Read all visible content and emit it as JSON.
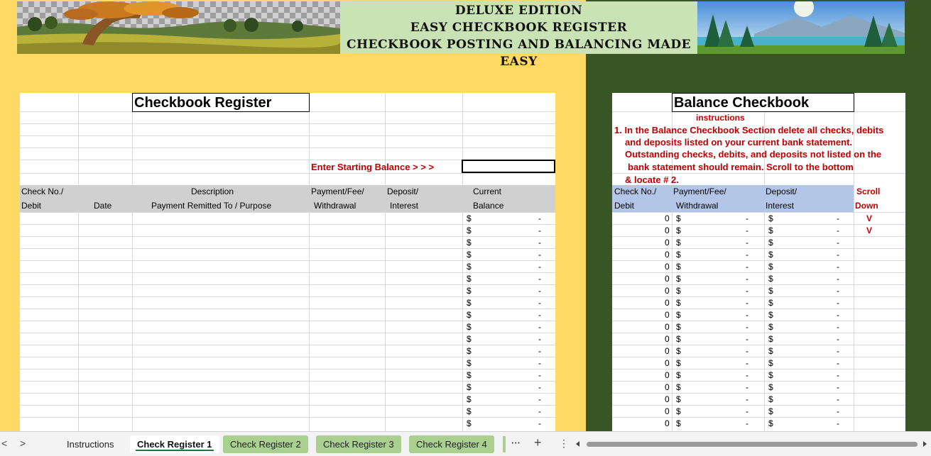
{
  "banner": {
    "line1": "DELUXE EDITION",
    "line2": "EASY CHECKBOOK REGISTER",
    "line3": "CHECKBOOK POSTING AND BALANCING MADE EASY"
  },
  "register": {
    "title": "Checkbook Register",
    "start_balance_label": "Enter Starting Balance > > >",
    "start_balance_value": "",
    "headers": {
      "check_no_1": "Check No./",
      "check_no_2": "Debit",
      "date": "Date",
      "desc_1": "Description",
      "desc_2": "Payment Remitted To / Purpose",
      "payment_1": "Payment/Fee/",
      "payment_2": "Withdrawal",
      "deposit_1": "Deposit/",
      "deposit_2": "Interest",
      "balance_1": "Current",
      "balance_2": "Balance"
    },
    "currency": "$",
    "empty_amount": "-"
  },
  "balance": {
    "title": "Balance Checkbook",
    "instructions_label": "instructions",
    "instruction_lines": [
      "1. In the Balance Checkbook Section delete all checks, debits",
      "and deposits listed on your current bank statement.",
      "Outstanding checks, debits, and deposits not listed on the",
      "bank statement should remain.  Scroll to the bottom",
      "& locate # 2."
    ],
    "headers": {
      "check_no_1": "Check No./",
      "check_no_2": "Debit",
      "payment_1": "Payment/Fee/",
      "payment_2": "Withdrawal",
      "deposit_1": "Deposit/",
      "deposit_2": "Interest",
      "scroll_1": "Scroll",
      "scroll_2": "Down"
    },
    "row_check_value": "0",
    "currency": "$",
    "empty_amount": "-",
    "scroll_arrows": [
      "V",
      "V"
    ]
  },
  "tabs": {
    "nav_prev": "<",
    "nav_next": ">",
    "items": [
      {
        "label": "Instructions"
      },
      {
        "label": "Check Register 1"
      },
      {
        "label": "Check Register 2"
      },
      {
        "label": "Check Register 3"
      },
      {
        "label": "Check Register 4"
      }
    ],
    "more": "···",
    "add": "+",
    "options": "⋮"
  },
  "colors": {
    "left_background": "#ffd966",
    "right_background": "#375623",
    "left_header": "#d0d0d0",
    "right_header": "#b4c6e7",
    "instruction_text": "#c00000",
    "banner_center": "#c9e3b5",
    "tab_green": "#a9d08e"
  }
}
